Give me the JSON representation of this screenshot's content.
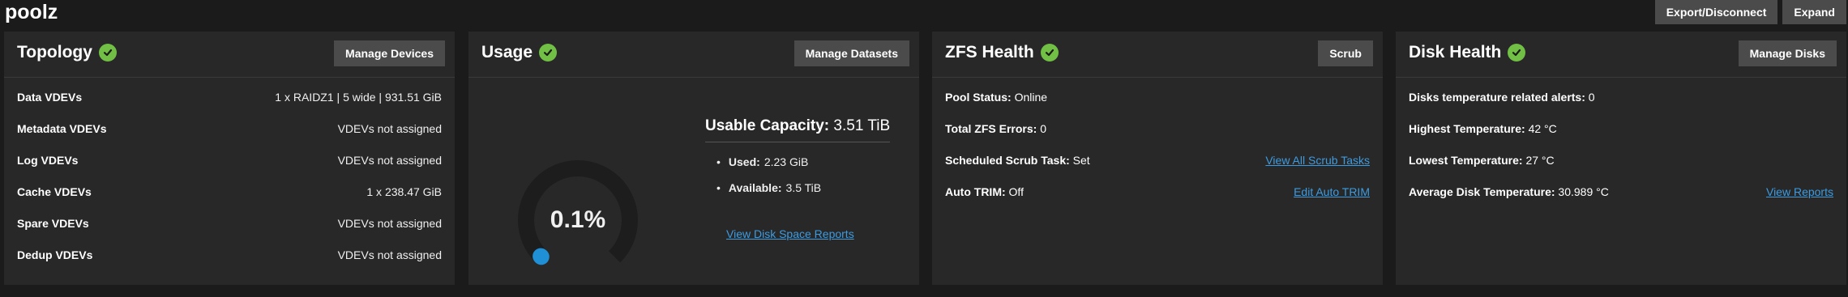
{
  "pool": {
    "title": "poolz"
  },
  "actions": {
    "export_label": "Export/Disconnect",
    "expand_label": "Expand"
  },
  "colors": {
    "healthy": "#71bf44",
    "link": "#3d9be0",
    "button": "#4b4b4b",
    "card": "#282828"
  },
  "topology": {
    "title": "Topology",
    "button": "Manage Devices",
    "rows": [
      {
        "label": "Data VDEVs",
        "value": "1 x RAIDZ1 | 5 wide | 931.51 GiB"
      },
      {
        "label": "Metadata VDEVs",
        "value": "VDEVs not assigned"
      },
      {
        "label": "Log VDEVs",
        "value": "VDEVs not assigned"
      },
      {
        "label": "Cache VDEVs",
        "value": "1 x 238.47 GiB"
      },
      {
        "label": "Spare VDEVs",
        "value": "VDEVs not assigned"
      },
      {
        "label": "Dedup VDEVs",
        "value": "VDEVs not assigned"
      }
    ]
  },
  "usage": {
    "title": "Usage",
    "button": "Manage Datasets",
    "percent_label": "0.1%",
    "percent_value": 0.1,
    "capacity_label": "Usable Capacity:",
    "capacity_value": "3.51 TiB",
    "used_label": "Used:",
    "used_value": "2.23 GiB",
    "available_label": "Available:",
    "available_value": "3.5 TiB",
    "link": "View Disk Space Reports"
  },
  "zfs": {
    "title": "ZFS Health",
    "button": "Scrub",
    "pool_status_label": "Pool Status:",
    "pool_status_value": "Online",
    "errors_label": "Total ZFS Errors:",
    "errors_value": "0",
    "scrub_label": "Scheduled Scrub Task:",
    "scrub_value": "Set",
    "scrub_link": "View All Scrub Tasks",
    "trim_label": "Auto TRIM:",
    "trim_value": "Off",
    "trim_link": "Edit Auto TRIM"
  },
  "disk": {
    "title": "Disk Health",
    "button": "Manage Disks",
    "alerts_label": "Disks temperature related alerts:",
    "alerts_value": "0",
    "highest_label": "Highest Temperature:",
    "highest_value": "42 °C",
    "lowest_label": "Lowest Temperature:",
    "lowest_value": "27 °C",
    "average_label": "Average Disk Temperature:",
    "average_value": "30.989 °C",
    "link": "View Reports"
  }
}
